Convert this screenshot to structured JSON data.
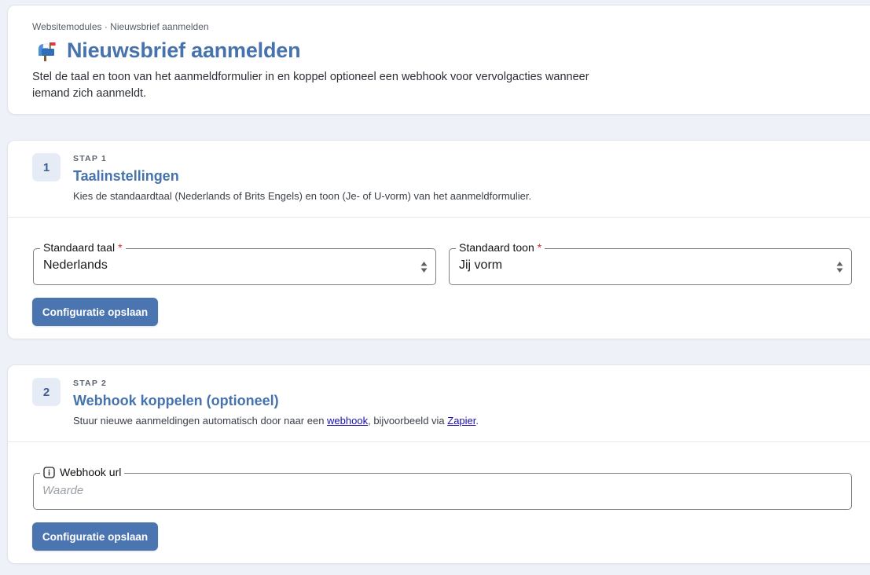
{
  "header": {
    "breadcrumb": "Websitemodules · Nieuwsbrief aanmelden",
    "icon": "mailbox-icon",
    "title": "Nieuwsbrief aanmelden",
    "description": "Stel de taal en toon van het aanmeldformulier in en koppel optioneel een webhook voor vervolgacties wanneer iemand zich aanmeldt."
  },
  "step1": {
    "number": "1",
    "kicker": "STAP 1",
    "title": "Taalinstellingen",
    "description": "Kies de standaardtaal (Nederlands of Brits Engels) en toon (Je- of U-vorm) van het aanmeldformulier.",
    "language_field": {
      "label": "Standaard taal",
      "required_mark": "*",
      "value": "Nederlands"
    },
    "tone_field": {
      "label": "Standaard toon",
      "required_mark": "*",
      "value": "Jij vorm"
    },
    "save_label": "Configuratie opslaan"
  },
  "step2": {
    "number": "2",
    "kicker": "STAP 2",
    "title": "Webhook koppelen (optioneel)",
    "description_before": "Stuur nieuwe aanmeldingen automatisch door naar een ",
    "webhook_link": "webhook",
    "description_middle": ", bijvoorbeeld via ",
    "zapier_link": "Zapier",
    "description_after": ".",
    "webhook_field": {
      "label": "Webhook url",
      "placeholder": "Waarde",
      "value": ""
    },
    "save_label": "Configuratie opslaan"
  },
  "colors": {
    "accent": "#4673ad",
    "button": "#4b75b0",
    "background": "#eef2f8",
    "required": "#d32f2f",
    "link": "#1a0dab"
  }
}
